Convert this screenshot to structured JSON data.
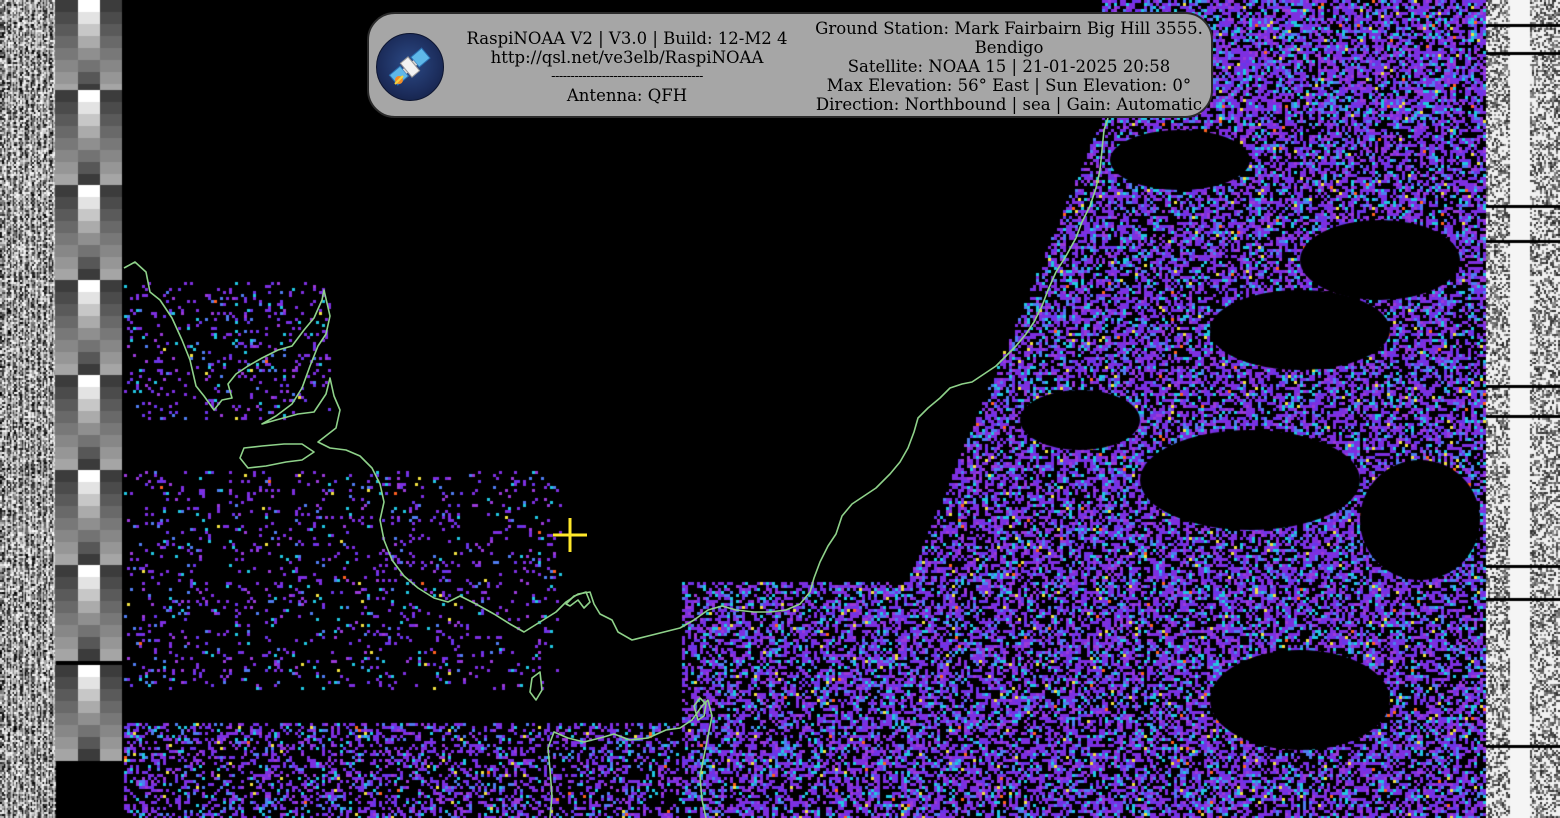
{
  "header": {
    "line1": "RaspiNOAA V2 | V3.0 | Build: 12-M2 4",
    "line2": "http://qsl.net/ve3elb/RaspiNOAA",
    "separator": "---------------------------------------",
    "antenna": "Antenna: QFH"
  },
  "station": {
    "ground_station": "Ground Station: Mark Fairbairn Big Hill 3555.",
    "location": "Bendigo",
    "satellite": "Satellite: NOAA 15 | 21-01-2025 20:58",
    "elevation": "Max Elevation: 56° East | Sun Elevation: 0°",
    "direction": "Direction: Northbound | sea | Gain: Automatic"
  },
  "colors": {
    "coastline": "#8fd28a",
    "cloud_primary": "#7d2fe0",
    "cloud_secondary": "#4f7cf0",
    "cloud_highlight": "#21c6e0",
    "crosshair": "#ffe82a",
    "overlay_bg": "#a6a6a6"
  },
  "icons": [
    "satellite-logo-icon",
    "crosshair-icon"
  ]
}
